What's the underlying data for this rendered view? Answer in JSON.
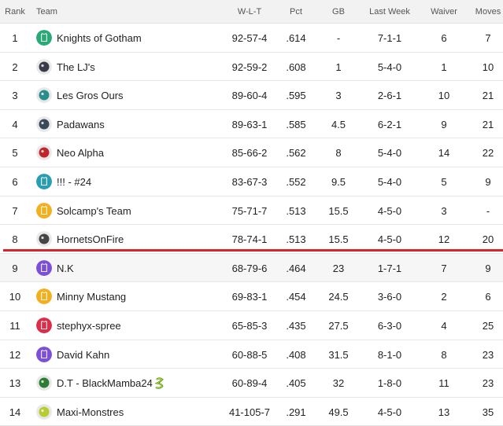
{
  "headers": {
    "rank": "Rank",
    "team": "Team",
    "wlt": "W-L-T",
    "pct": "Pct",
    "gb": "GB",
    "last_week": "Last Week",
    "waiver": "Waiver",
    "moves": "Moves"
  },
  "rows": [
    {
      "rank": "1",
      "team": "Knights of Gotham",
      "wlt": "92-57-4",
      "pct": ".614",
      "gb": "-",
      "last_week": "7-1-1",
      "waiver": "6",
      "moves": "7",
      "icon": "knight-jersey-icon",
      "color": "#2aa876"
    },
    {
      "rank": "2",
      "team": "The LJ's",
      "wlt": "92-59-2",
      "pct": ".608",
      "gb": "1",
      "last_week": "5-4-0",
      "waiver": "1",
      "moves": "10",
      "icon": "team-logo-icon",
      "color": "#3a3a4a"
    },
    {
      "rank": "3",
      "team": "Les Gros Ours",
      "wlt": "89-60-4",
      "pct": ".595",
      "gb": "3",
      "last_week": "2-6-1",
      "waiver": "10",
      "moves": "21",
      "icon": "bear-logo-icon",
      "color": "#2b8c8c"
    },
    {
      "rank": "4",
      "team": "Padawans",
      "wlt": "89-63-1",
      "pct": ".585",
      "gb": "4.5",
      "last_week": "6-2-1",
      "waiver": "9",
      "moves": "21",
      "icon": "padawan-logo-icon",
      "color": "#3b4a5a"
    },
    {
      "rank": "5",
      "team": "Neo Alpha",
      "wlt": "85-66-2",
      "pct": ".562",
      "gb": "8",
      "last_week": "5-4-0",
      "waiver": "14",
      "moves": "22",
      "icon": "wolf-logo-icon",
      "color": "#c0262d"
    },
    {
      "rank": "6",
      "team": "!!! - #24",
      "wlt": "83-67-3",
      "pct": ".552",
      "gb": "9.5",
      "last_week": "5-4-0",
      "waiver": "5",
      "moves": "9",
      "icon": "jersey-icon",
      "color": "#2a9db0"
    },
    {
      "rank": "7",
      "team": "Solcamp's Team",
      "wlt": "75-71-7",
      "pct": ".513",
      "gb": "15.5",
      "last_week": "4-5-0",
      "waiver": "3",
      "moves": "-",
      "icon": "jersey-icon",
      "color": "#f0b020"
    },
    {
      "rank": "8",
      "team": "HornetsOnFire",
      "wlt": "78-74-1",
      "pct": ".513",
      "gb": "15.5",
      "last_week": "4-5-0",
      "waiver": "12",
      "moves": "20",
      "icon": "hornet-logo-icon",
      "color": "#444444"
    },
    {
      "rank": "9",
      "team": "N.K",
      "wlt": "68-79-6",
      "pct": ".464",
      "gb": "23",
      "last_week": "1-7-1",
      "waiver": "7",
      "moves": "9",
      "icon": "jersey-icon",
      "color": "#7b4fd6"
    },
    {
      "rank": "10",
      "team": "Minny Mustang",
      "wlt": "69-83-1",
      "pct": ".454",
      "gb": "24.5",
      "last_week": "3-6-0",
      "waiver": "2",
      "moves": "6",
      "icon": "jersey-icon",
      "color": "#f0b020"
    },
    {
      "rank": "11",
      "team": "stephyx-spree",
      "wlt": "65-85-3",
      "pct": ".435",
      "gb": "27.5",
      "last_week": "6-3-0",
      "waiver": "4",
      "moves": "25",
      "icon": "jersey-icon",
      "color": "#d8304a"
    },
    {
      "rank": "12",
      "team": "David Kahn",
      "wlt": "60-88-5",
      "pct": ".408",
      "gb": "31.5",
      "last_week": "8-1-0",
      "waiver": "8",
      "moves": "23",
      "icon": "jersey-icon",
      "color": "#7b4fd6"
    },
    {
      "rank": "13",
      "team": "D.T - BlackMamba24",
      "wlt": "60-89-4",
      "pct": ".405",
      "gb": "32",
      "last_week": "1-8-0",
      "waiver": "11",
      "moves": "23",
      "icon": "rebel-logo-icon",
      "color": "#2e7d32",
      "badge": "snake-icon"
    },
    {
      "rank": "14",
      "team": "Maxi-Monstres",
      "wlt": "41-105-7",
      "pct": ".291",
      "gb": "49.5",
      "last_week": "4-5-0",
      "waiver": "13",
      "moves": "35",
      "icon": "octopus-logo-icon",
      "color": "#b8cc30"
    }
  ],
  "colors": {
    "header_bg": "#f2f2f2",
    "playoff_line": "#d9242c"
  }
}
